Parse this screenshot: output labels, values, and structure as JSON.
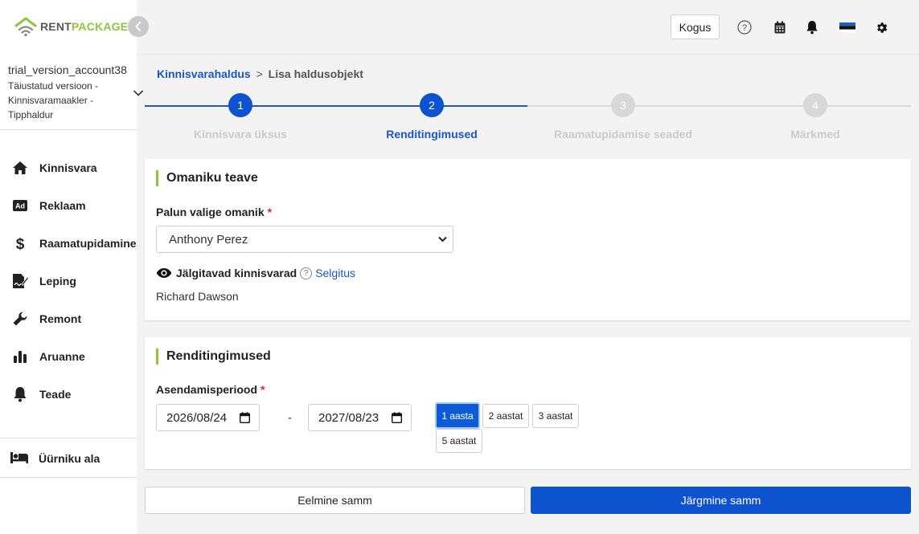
{
  "brand": {
    "logo_part1": "RENT",
    "logo_part2": "PACKAGE",
    "colors": {
      "accent_green": "#8cc63f",
      "primary_blue": "#0d52cf",
      "link_blue": "#1a56c4"
    }
  },
  "account": {
    "name": "trial_version_account38",
    "subtitle": "Täiustatud versioon - Kinnisvaramaakler - Tipphaldur"
  },
  "sidebar": {
    "items": [
      {
        "label": "Kinnisvara",
        "icon": "home-icon"
      },
      {
        "label": "Reklaam",
        "icon": "ad-icon"
      },
      {
        "label": "Raamatupidamine",
        "icon": "dollar-icon"
      },
      {
        "label": "Leping",
        "icon": "contract-icon"
      },
      {
        "label": "Remont",
        "icon": "wrench-icon"
      },
      {
        "label": "Aruanne",
        "icon": "bar-chart-icon"
      },
      {
        "label": "Teade",
        "icon": "bell-icon"
      }
    ],
    "tenant_area": {
      "label": "Üürniku ala",
      "icon": "bed-icon"
    }
  },
  "topbar": {
    "kogus_label": "Kogus",
    "icons": [
      "help-icon",
      "calendar-icon",
      "bell-icon",
      "estonian-flag-icon",
      "gear-icon"
    ]
  },
  "breadcrumb": {
    "root": "Kinnisvarahaldus",
    "separator": ">",
    "current": "Lisa haldusobjekt"
  },
  "stepper": {
    "current_step": 2,
    "steps": [
      {
        "number": "1",
        "label": "Kinnisvara üksus"
      },
      {
        "number": "2",
        "label": "Renditingimused"
      },
      {
        "number": "3",
        "label": "Raamatupidamise seaded"
      },
      {
        "number": "4",
        "label": "Märkmed"
      }
    ]
  },
  "owner_section": {
    "title": "Omaniku teave",
    "owner_label": "Palun valige omanik",
    "required_mark": "*",
    "selected_owner": "Anthony Perez",
    "tracked_label": "Jälgitavad kinnisvarad",
    "help_mark": "?",
    "explanation_link": "Selgitus",
    "tracked_name": "Richard Dawson"
  },
  "rental_section": {
    "title": "Renditingimused",
    "period_label": "Asendamisperiood",
    "required_mark": "*",
    "start_date": "2026/08/24",
    "end_date": "2027/08/23",
    "range_separator": "-",
    "period_buttons": [
      {
        "label": "1 aasta",
        "active": true
      },
      {
        "label": "2 aastat",
        "active": false
      },
      {
        "label": "3 aastat",
        "active": false
      },
      {
        "label": "5 aastat",
        "active": false
      }
    ]
  },
  "footer": {
    "prev_label": "Eelmine samm",
    "next_label": "Järgmine samm"
  }
}
